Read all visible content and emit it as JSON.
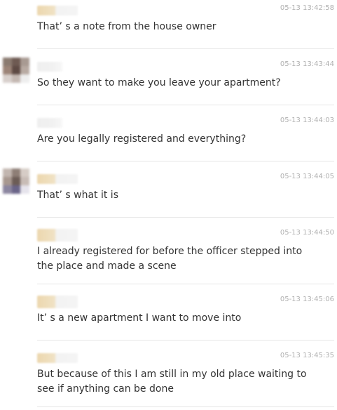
{
  "messages": [
    {
      "time": "05-13 13:42:58",
      "text": "That’ s a note from the house owner"
    },
    {
      "time": "05-13 13:43:44",
      "text": "So they want to make you leave your apartment?"
    },
    {
      "time": "05-13 13:44:03",
      "text": "Are you legally registered and everything?"
    },
    {
      "time": "05-13 13:44:05",
      "text": "That’ s what it is"
    },
    {
      "time": "05-13 13:44:50",
      "text": "I already registered for before the officer stepped into the place and made a scene"
    },
    {
      "time": "05-13 13:45:06",
      "text": "It’ s a new apartment I want to move into"
    },
    {
      "time": "05-13 13:45:35",
      "text": "But because of this I am still in my old place waiting to see if anything can be done"
    }
  ]
}
